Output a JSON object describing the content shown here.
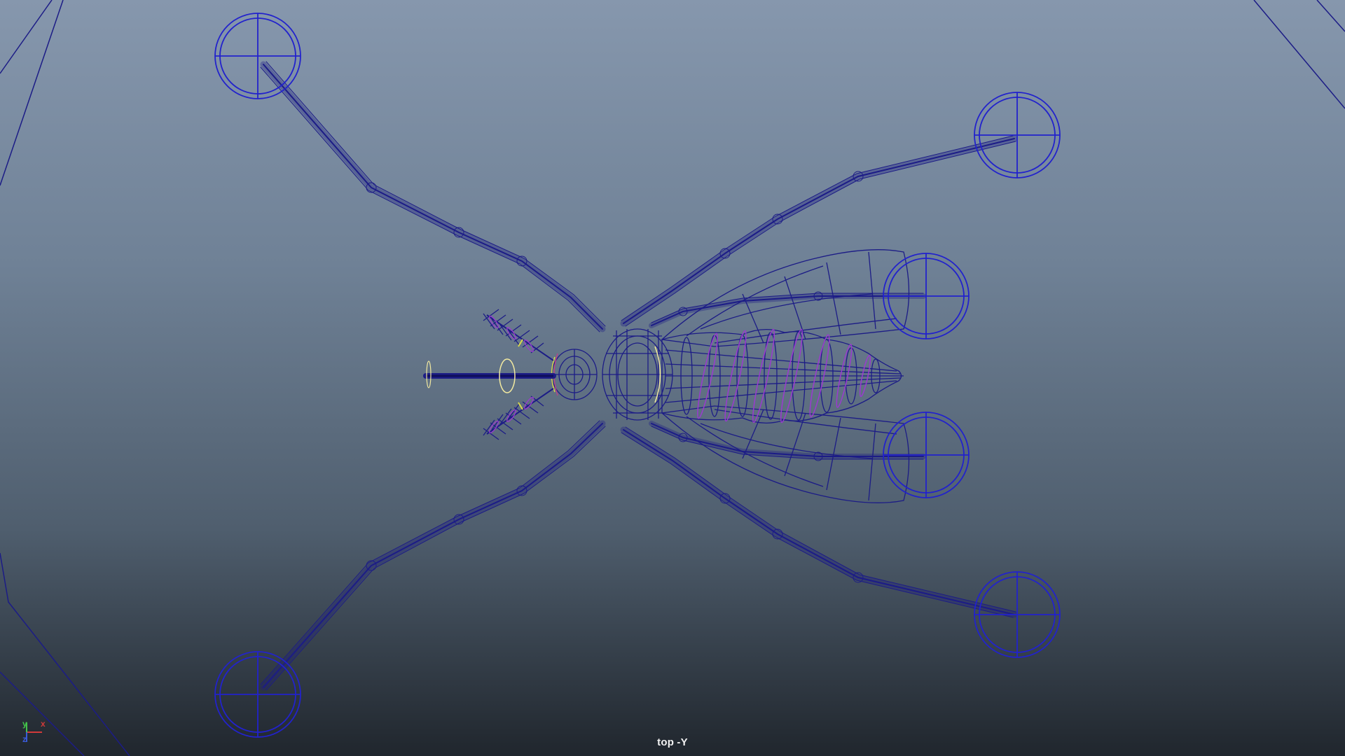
{
  "viewport": {
    "camera_label": "top -Y",
    "background_top": "#8697ad",
    "background_bottom": "#20262d"
  },
  "axis_gizmo": {
    "x_label": "x",
    "y_label": "y",
    "z_label": "z",
    "x_color": "#d23a3a",
    "y_color": "#43c24a",
    "z_color": "#3a5ad8"
  },
  "colors": {
    "wireframe": "#1c1c86",
    "controller": "#2222cc",
    "deformer": "#9a3ad0",
    "selected_control": "#f2e9a0",
    "highlight": "#d8d84a"
  },
  "icons": {
    "foot_controller": "circle-crosshair-icon",
    "axis_gizmo": "xyz-axis-icon"
  }
}
